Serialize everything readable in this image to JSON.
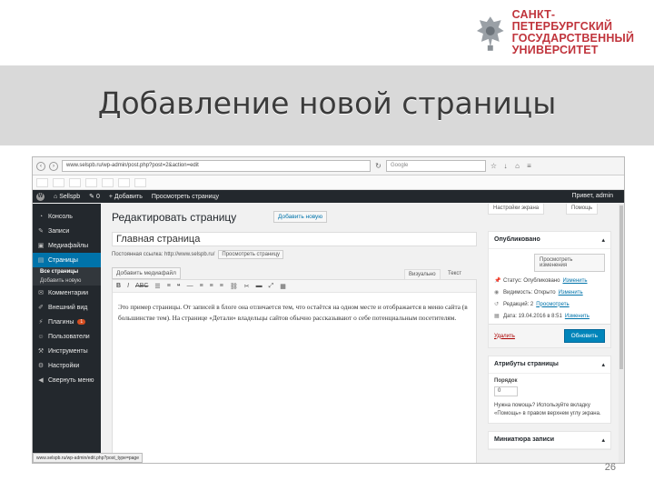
{
  "logo": {
    "line1": "САНКТ-ПЕТЕРБУРГСКИЙ",
    "line2": "ГОСУДАРСТВЕННЫЙ",
    "line3": "УНИВЕРСИТЕТ",
    "color": "#c0343c"
  },
  "slide": {
    "title": "Добавление новой страницы",
    "page_number": "26"
  },
  "browser": {
    "url": "www.selspb.ru/wp-admin/post.php?post=2&action=edit",
    "search_placeholder": "Google"
  },
  "adminbar": {
    "site_name": "Sellspb",
    "add_label": "Добавить",
    "view_label": "Просмотреть страницу",
    "greeting": "Привет, admin"
  },
  "sidebar": {
    "items": [
      {
        "label": "Консоль",
        "icon": "dashboard-icon"
      },
      {
        "label": "Записи",
        "icon": "pin-icon"
      },
      {
        "label": "Медиафайлы",
        "icon": "media-icon"
      },
      {
        "label": "Страницы",
        "icon": "pages-icon"
      },
      {
        "label": "Комментарии",
        "icon": "comment-icon"
      },
      {
        "label": "Внешний вид",
        "icon": "brush-icon"
      },
      {
        "label": "Плагины",
        "icon": "plugin-icon",
        "badge": "1"
      },
      {
        "label": "Пользователи",
        "icon": "users-icon"
      },
      {
        "label": "Инструменты",
        "icon": "tools-icon"
      },
      {
        "label": "Настройки",
        "icon": "settings-icon"
      },
      {
        "label": "Свернуть меню",
        "icon": "collapse-icon"
      }
    ],
    "subitems": [
      "Все страницы",
      "Добавить новую"
    ]
  },
  "main": {
    "heading": "Редактировать страницу",
    "add_new": "Добавить новую",
    "screen_options": "Настройки экрана",
    "help": "Помощь",
    "title_value": "Главная страница",
    "permalink_label": "Постоянная ссылка: http://www.selspb.ru/",
    "permalink_button": "Просмотреть страницу",
    "add_media": "Добавить медиафайл",
    "tab_visual": "Визуально",
    "tab_text": "Текст",
    "content": "Это пример страницы. От записей в блоге она отличается тем, что остаётся на одном месте и отображается в меню сайта (в большинстве тем). На странице «Детали» владельцы сайтов обычно рассказывают о себе потенциальным посетителям.",
    "status_url": "www.selspb.ru/wp-admin/edit.php?post_type=page"
  },
  "publish": {
    "title": "Опубликовано",
    "preview_button": "Просмотреть изменения",
    "status_label": "Статус: Опубликовано",
    "status_link": "Изменить",
    "visibility_label": "Видимость: Открыто",
    "visibility_link": "Изменить",
    "revisions_label": "Редакций: 2",
    "revisions_link": "Просмотреть",
    "date_label": "Дата: 19.04.2016 в 8:51",
    "date_link": "Изменить",
    "trash": "Удалить",
    "update": "Обновить"
  },
  "attributes": {
    "title": "Атрибуты страницы",
    "order_label": "Порядок",
    "order_value": "0",
    "help_text": "Нужна помощь? Используйте вкладку «Помощь» в правом верхнем углу экрана."
  },
  "thumbnail": {
    "title": "Миниатюра записи"
  }
}
